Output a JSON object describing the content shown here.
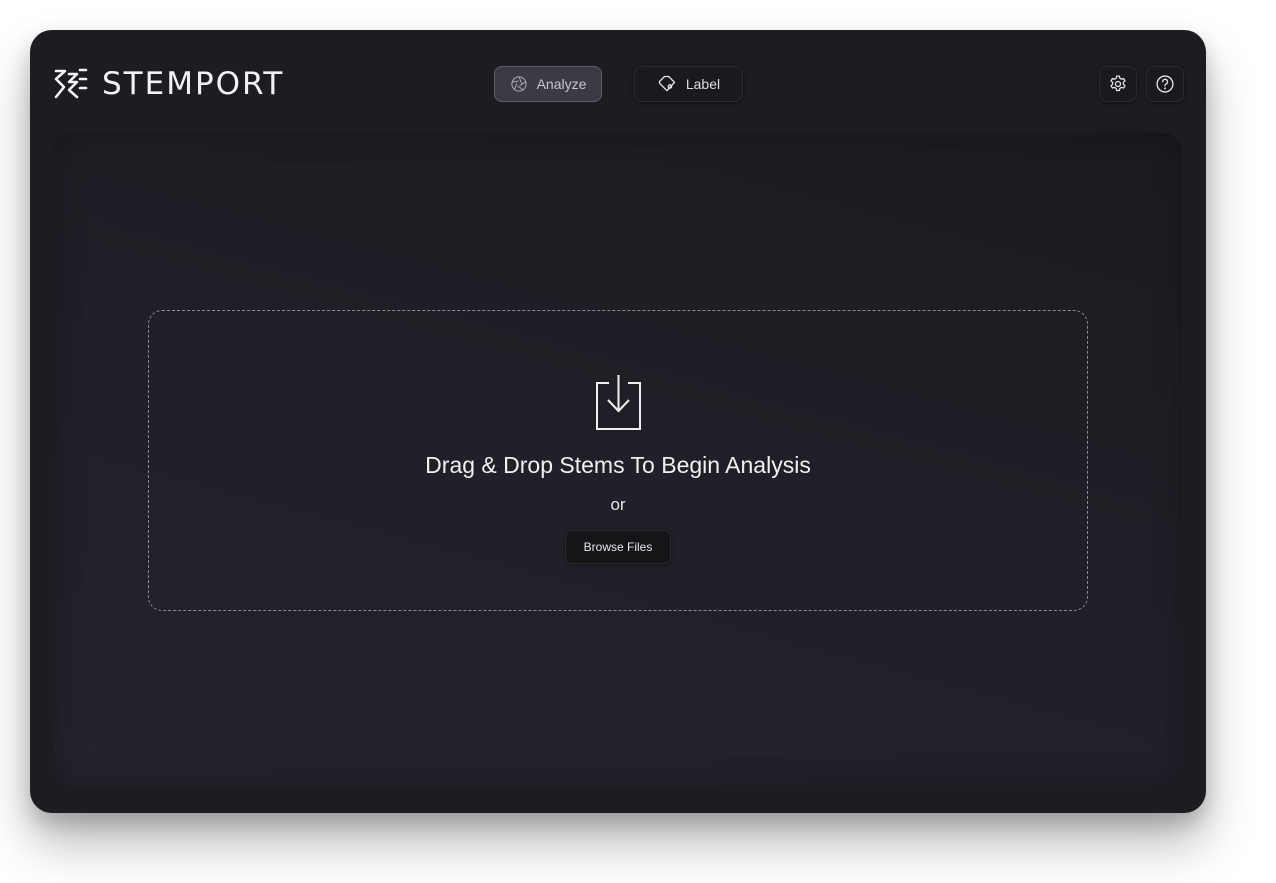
{
  "app": {
    "name": "STEMPORT",
    "logo_icon": "stemport-logo-icon"
  },
  "nav": {
    "analyze": {
      "label": "Analyze",
      "icon": "aperture-icon",
      "active": true
    },
    "label": {
      "label": "Label",
      "icon": "tag-icon",
      "active": false
    }
  },
  "toolbar": {
    "settings_icon": "gear-icon",
    "help_icon": "help-icon"
  },
  "dropzone": {
    "icon": "download-tray-icon",
    "title": "Drag & Drop Stems To Begin Analysis",
    "separator": "or",
    "browse_label": "Browse Files"
  },
  "colors": {
    "window_bg": "#1d1d21",
    "accent_active": "#3b3b45",
    "text": "#f0f0f3",
    "dashed_border": "#8a8a94"
  }
}
